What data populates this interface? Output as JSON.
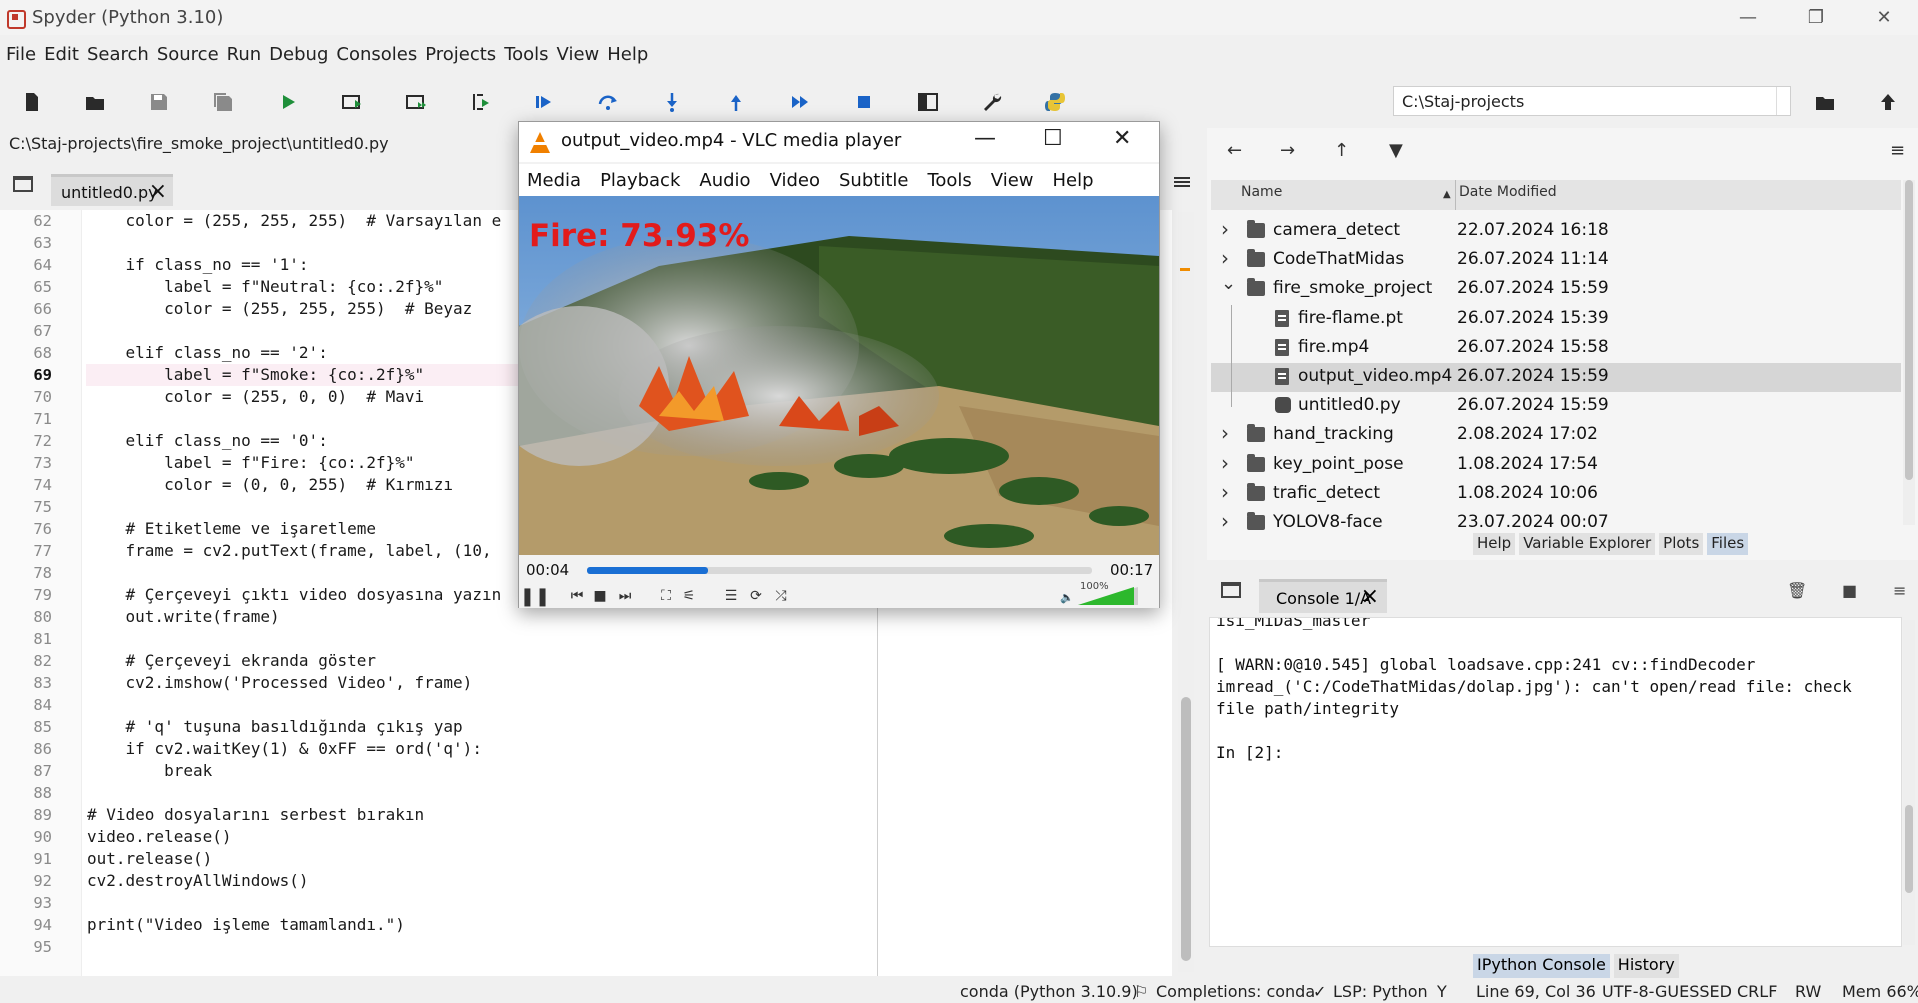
{
  "window": {
    "title": "Spyder (Python 3.10)"
  },
  "menu": [
    "File",
    "Edit",
    "Search",
    "Source",
    "Run",
    "Debug",
    "Consoles",
    "Projects",
    "Tools",
    "View",
    "Help"
  ],
  "toolbar": {
    "path": "C:\\Staj-projects"
  },
  "editor": {
    "file_path": "C:\\Staj-projects\\fire_smoke_project\\untitled0.py",
    "tab_label": "untitled0.py",
    "current_line": "69",
    "lines": [
      {
        "n": "62",
        "code": "    color = (255, 255, 255)  # Varsayılan e"
      },
      {
        "n": "63",
        "code": ""
      },
      {
        "n": "64",
        "code": "    if class_no == '1':"
      },
      {
        "n": "65",
        "code": "        label = f\"Neutral: {co:.2f}%\""
      },
      {
        "n": "66",
        "code": "        color = (255, 255, 255)  # Beyaz"
      },
      {
        "n": "67",
        "code": ""
      },
      {
        "n": "68",
        "code": "    elif class_no == '2':"
      },
      {
        "n": "69",
        "code": "        label = f\"Smoke: {co:.2f}%\""
      },
      {
        "n": "70",
        "code": "        color = (255, 0, 0)  # Mavi"
      },
      {
        "n": "71",
        "code": ""
      },
      {
        "n": "72",
        "code": "    elif class_no == '0':"
      },
      {
        "n": "73",
        "code": "        label = f\"Fire: {co:.2f}%\""
      },
      {
        "n": "74",
        "code": "        color = (0, 0, 255)  # Kırmızı"
      },
      {
        "n": "75",
        "code": ""
      },
      {
        "n": "76",
        "code": "    # Etiketleme ve işaretleme"
      },
      {
        "n": "77",
        "code": "    frame = cv2.putText(frame, label, (10,"
      },
      {
        "n": "78",
        "code": ""
      },
      {
        "n": "79",
        "code": "    # Çerçeveyi çıktı video dosyasına yazın"
      },
      {
        "n": "80",
        "code": "    out.write(frame)"
      },
      {
        "n": "81",
        "code": ""
      },
      {
        "n": "82",
        "code": "    # Çerçeveyi ekranda göster"
      },
      {
        "n": "83",
        "code": "    cv2.imshow('Processed Video', frame)"
      },
      {
        "n": "84",
        "code": ""
      },
      {
        "n": "85",
        "code": "    # 'q' tuşuna basıldığında çıkış yap"
      },
      {
        "n": "86",
        "code": "    if cv2.waitKey(1) & 0xFF == ord('q'):"
      },
      {
        "n": "87",
        "code": "        break"
      },
      {
        "n": "88",
        "code": ""
      },
      {
        "n": "89",
        "code": "# Video dosyalarını serbest bırakın"
      },
      {
        "n": "90",
        "code": "video.release()"
      },
      {
        "n": "91",
        "code": "out.release()"
      },
      {
        "n": "92",
        "code": "cv2.destroyAllWindows()"
      },
      {
        "n": "93",
        "code": ""
      },
      {
        "n": "94",
        "code": "print(\"Video işleme tamamlandı.\")"
      },
      {
        "n": "95",
        "code": ""
      }
    ]
  },
  "files": {
    "col_name": "Name",
    "col_date": "Date Modified",
    "rows": [
      {
        "name": "camera_detect",
        "date": "22.07.2024 16:18",
        "type": "folder",
        "level": 0,
        "expanded": false
      },
      {
        "name": "CodeThatMidas",
        "date": "26.07.2024 11:14",
        "type": "folder",
        "level": 0,
        "expanded": false
      },
      {
        "name": "fire_smoke_project",
        "date": "26.07.2024 15:59",
        "type": "folder",
        "level": 0,
        "expanded": true
      },
      {
        "name": "fire-flame.pt",
        "date": "26.07.2024 15:39",
        "type": "file",
        "level": 1
      },
      {
        "name": "fire.mp4",
        "date": "26.07.2024 15:58",
        "type": "file",
        "level": 1
      },
      {
        "name": "output_video.mp4",
        "date": "26.07.2024 15:59",
        "type": "file",
        "level": 1,
        "selected": true
      },
      {
        "name": "untitled0.py",
        "date": "26.07.2024 15:59",
        "type": "py",
        "level": 1
      },
      {
        "name": "hand_tracking",
        "date": "2.08.2024 17:02",
        "type": "folder",
        "level": 0,
        "expanded": false
      },
      {
        "name": "key_point_pose",
        "date": "1.08.2024 17:54",
        "type": "folder",
        "level": 0,
        "expanded": false
      },
      {
        "name": "trafic_detect",
        "date": "1.08.2024 10:06",
        "type": "folder",
        "level": 0,
        "expanded": false
      },
      {
        "name": "YOLOV8-face",
        "date": "23.07.2024 00:07",
        "type": "folder",
        "level": 0,
        "expanded": false
      }
    ]
  },
  "pane_tabs": [
    "Help",
    "Variable Explorer",
    "Plots",
    "Files"
  ],
  "pane_tabs_active": "Files",
  "console": {
    "tab_label": "Console 1/A",
    "lines": [
      "isi_MiDaS_master",
      "",
      "[ WARN:0@10.545] global loadsave.cpp:241 cv::findDecoder",
      "imread_('C:/CodeThatMidas/dolap.jpg'): can't open/read file: check",
      "file path/integrity",
      "",
      "In [2]:"
    ],
    "bottom_tabs": [
      "IPython Console",
      "History"
    ]
  },
  "status": {
    "env": "conda (Python 3.10.9)",
    "completions": "Completions: conda",
    "lsp": "LSP: Python",
    "position": "Line 69, Col 36",
    "encoding": "UTF-8-GUESSED",
    "eol": "CRLF",
    "perm": "RW",
    "mem": "Mem 66%"
  },
  "vlc": {
    "title": "output_video.mp4 - VLC media player",
    "menu": [
      "Media",
      "Playback",
      "Audio",
      "Video",
      "Subtitle",
      "Tools",
      "View",
      "Help"
    ],
    "overlay": "Fire: 73.93%",
    "elapsed": "00:04",
    "total": "00:17",
    "progress": 0.24,
    "volume": "100%"
  }
}
